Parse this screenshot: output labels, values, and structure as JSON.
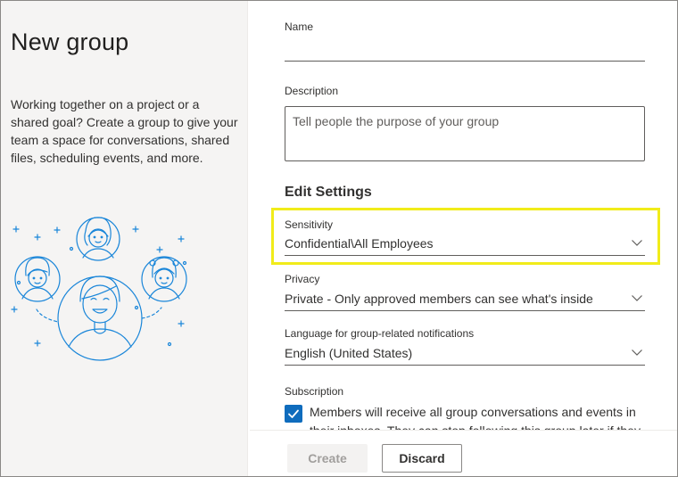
{
  "page": {
    "title": "New group",
    "intro": "Working together on a project or a shared goal? Create a group to give your team a space for conversations, shared files, scheduling events, and more."
  },
  "form": {
    "name_label": "Name",
    "name_value": "",
    "description_label": "Description",
    "description_placeholder": "Tell people the purpose of your group",
    "section_title": "Edit Settings",
    "sensitivity_label": "Sensitivity",
    "sensitivity_value": "Confidential\\All Employees",
    "privacy_label": "Privacy",
    "privacy_value": "Private - Only approved members can see what's inside",
    "language_label": "Language for group-related notifications",
    "language_value": "English (United States)",
    "subscription_label": "Subscription",
    "subscription_checked": true,
    "subscription_text": "Members will receive all group conversations and events in their inboxes. They can stop following this group later if they"
  },
  "footer": {
    "create_label": "Create",
    "discard_label": "Discard"
  },
  "colors": {
    "accent": "#0f6cbd",
    "highlight": "#f1ec1a",
    "illustration": "#1a86d9"
  },
  "icons": {
    "dropdown": "chevron-down-icon",
    "checkbox": "checkmark-icon",
    "illustration": "people-group-illustration"
  }
}
